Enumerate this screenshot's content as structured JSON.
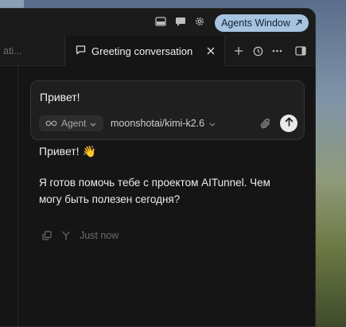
{
  "titlebar": {
    "agents_window_label": "Agents Window"
  },
  "tabs": {
    "previous_label": "ati...",
    "active_label": "Greeting conversation"
  },
  "composer": {
    "text": "Привет!",
    "mode_label": "Agent",
    "model_label": "moonshotai/kimi-k2.6"
  },
  "messages": {
    "greeting": "Привет! 👋",
    "body": "Я готов помочь тебе с проектом AITunnel. Чем могу быть полезен сегодня?",
    "timestamp": "Just now"
  },
  "colors": {
    "accent_button": "#a6c3e0",
    "window_bg": "#151515",
    "composer_bg": "#1f1f1f"
  },
  "icons": {
    "titlebar": [
      "layout-panel-icon",
      "chat-bubble-icon",
      "gear-icon",
      "arrow-up-right-icon"
    ],
    "tabbar": [
      "chat-icon",
      "close-icon",
      "plus-icon",
      "history-icon",
      "more-icon",
      "sidebar-toggle-icon"
    ],
    "composer": [
      "infinity-icon",
      "chevron-down-icon",
      "paperclip-icon",
      "arrow-up-icon"
    ],
    "message_actions": [
      "copy-icon",
      "fork-icon"
    ]
  }
}
